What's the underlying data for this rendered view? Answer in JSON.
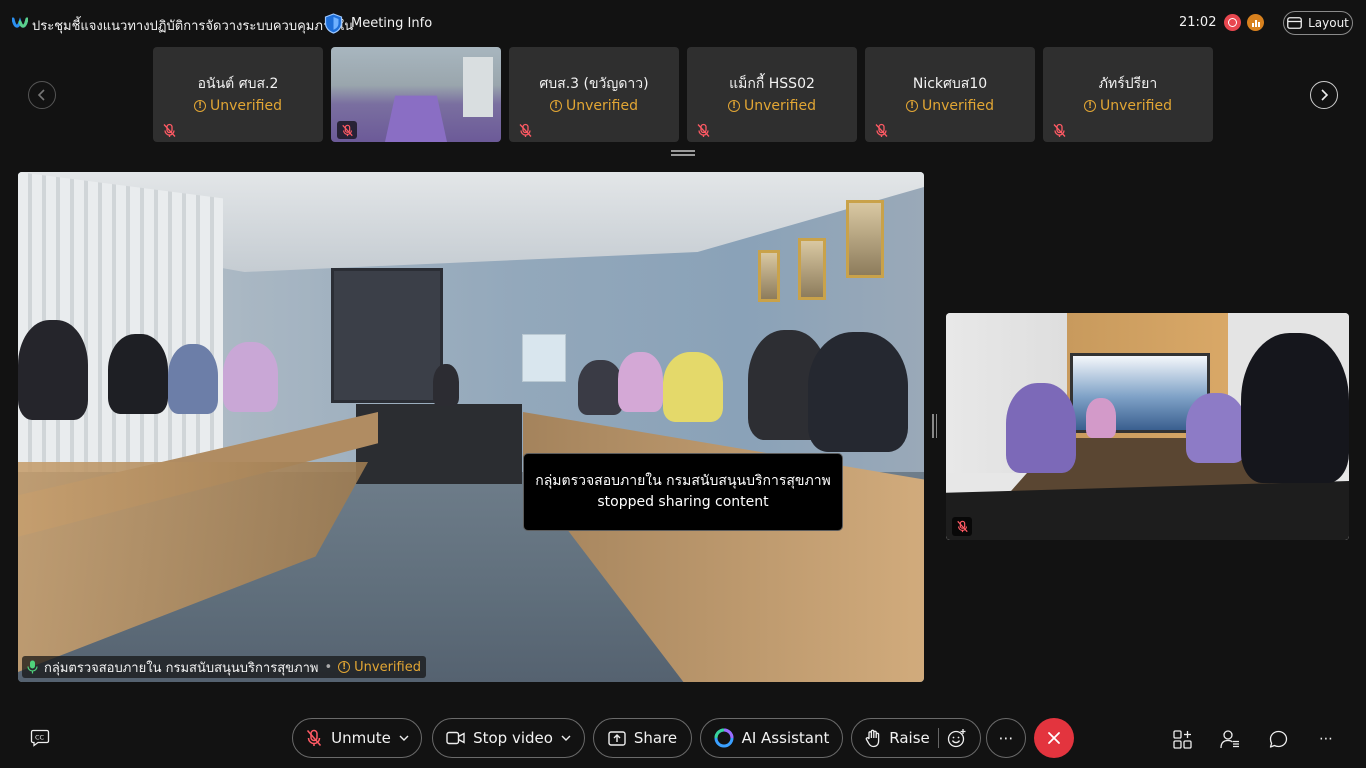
{
  "meeting": {
    "title": "ประชุมชี้แจงแนวทางปฏิบัติการจัดวางระบบควบคุมภายใน",
    "info_label": "Meeting Info",
    "clock": "21:02",
    "layout_label": "Layout"
  },
  "filmstrip": {
    "tiles": [
      {
        "name": "อนันต์ ศบส.2",
        "status": "Unverified"
      },
      {
        "name": "",
        "status": ""
      },
      {
        "name": "ศบส.3 (ขวัญดาว)",
        "status": "Unverified"
      },
      {
        "name": "แม็กกี้ HSS02",
        "status": "Unverified"
      },
      {
        "name": "Nickศบส10",
        "status": "Unverified"
      },
      {
        "name": "ภัทร์ปรียา",
        "status": "Unverified"
      }
    ]
  },
  "main_video": {
    "name": "กลุ่มตรวจสอบภายใน กรมสนับสนุนบริการสุขภาพ",
    "separator": "•",
    "status": "Unverified"
  },
  "toast": {
    "message": "กลุ่มตรวจสอบภายใน กรมสนับสนุนบริการสุขภาพ stopped sharing content"
  },
  "controls": {
    "unmute": "Unmute",
    "stop_video": "Stop video",
    "share": "Share",
    "ai_assistant": "AI Assistant",
    "raise": "Raise",
    "more": "⋯",
    "right_more": "⋯"
  },
  "colors": {
    "background": "#121212",
    "tile": "#2f2f2f",
    "unverified": "#e2a634",
    "leave": "#e3343e",
    "record": "#e8474f"
  }
}
